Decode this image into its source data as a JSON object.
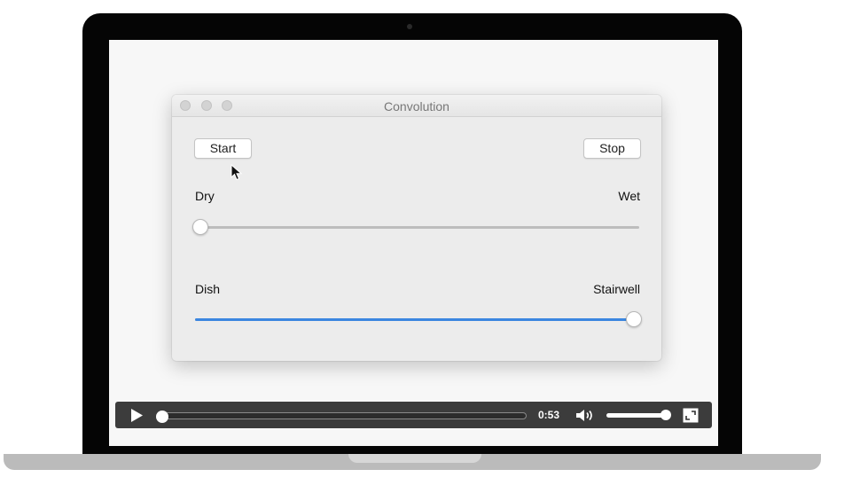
{
  "window": {
    "title": "Convolution"
  },
  "buttons": {
    "start": "Start",
    "stop": "Stop"
  },
  "slider_mix": {
    "left_label": "Dry",
    "right_label": "Wet",
    "value": 0.0
  },
  "slider_room": {
    "left_label": "Dish",
    "right_label": "Stairwell",
    "value": 1.0
  },
  "player": {
    "time": "0:53",
    "progress": 0.0,
    "volume": 1.0
  },
  "colors": {
    "accent": "#3b86e0",
    "track": "#bdbdbd",
    "controls_bar": "#303030"
  },
  "icons": {
    "play": "play-icon",
    "volume": "volume-icon",
    "fullscreen": "fullscreen-icon",
    "cursor": "mouse-pointer-icon"
  }
}
